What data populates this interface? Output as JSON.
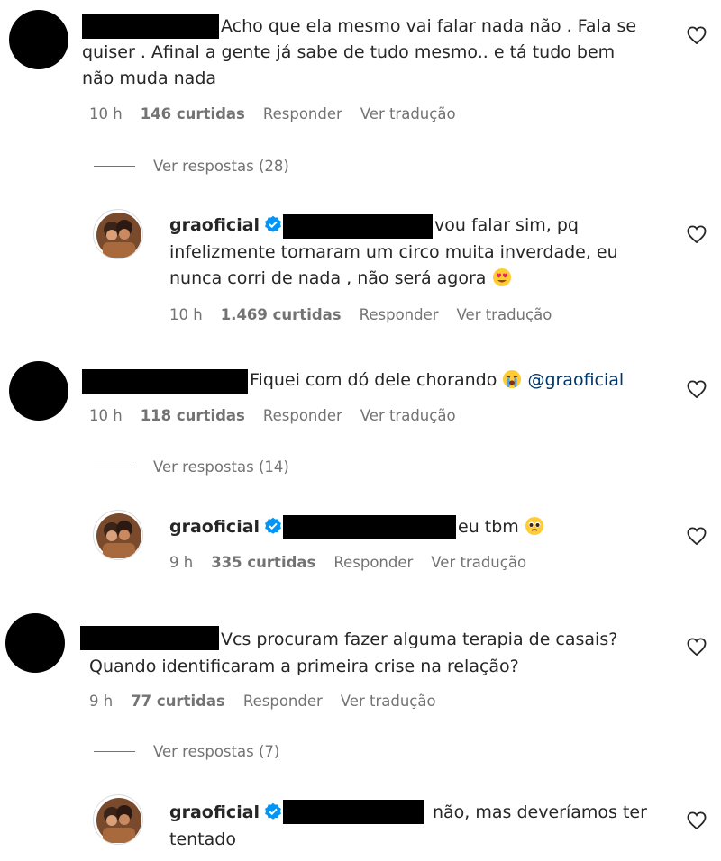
{
  "comments": [
    {
      "text": "Acho que ela mesmo vai falar nada não . Fala se quiser . Afinal a gente já sabe de tudo mesmo.. e tá tudo bem não muda nada",
      "line1": "Acho que ela mesmo vai falar nada não . Fala se",
      "line2": "quiser . Afinal a gente já sabe de tudo mesmo.. e tá tudo bem",
      "line3": "não muda nada",
      "time": "10 h",
      "likes": "146 curtidas",
      "reply": "Responder",
      "translate": "Ver tradução",
      "view_replies": "Ver respostas (28)",
      "reply_item": {
        "username": "graoficial",
        "line1": "vou falar sim, pq",
        "line2": "infelizmente tornaram um circo muita inverdade, eu",
        "line3": "nunca corri de nada , não será agora",
        "emoji": "heart-eyes-emoji",
        "time": "10 h",
        "likes": "1.469 curtidas",
        "reply": "Responder",
        "translate": "Ver tradução"
      }
    },
    {
      "line1": "Fiquei com dó dele chorando",
      "emoji": "loudly-crying-emoji",
      "mention": "@graoficial",
      "time": "10 h",
      "likes": "118 curtidas",
      "reply": "Responder",
      "translate": "Ver tradução",
      "view_replies": "Ver respostas (14)",
      "reply_item": {
        "username": "graoficial",
        "line1": "eu tbm",
        "emoji": "pleading-face-emoji",
        "time": "9 h",
        "likes": "335 curtidas",
        "reply": "Responder",
        "translate": "Ver tradução"
      }
    },
    {
      "line1": "Vcs procuram fazer alguma terapia de casais?",
      "line2": "Quando identificaram a primeira crise na relação?",
      "time": "9 h",
      "likes": "77 curtidas",
      "reply": "Responder",
      "translate": "Ver tradução",
      "view_replies": "Ver respostas (7)",
      "reply_item": {
        "username": "graoficial",
        "line1": "não, mas deveríamos ter",
        "line2": "tentado"
      }
    }
  ],
  "colors": {
    "text": "#262626",
    "meta": "#737373",
    "verified": "#0095f6",
    "mention": "#00376b"
  }
}
